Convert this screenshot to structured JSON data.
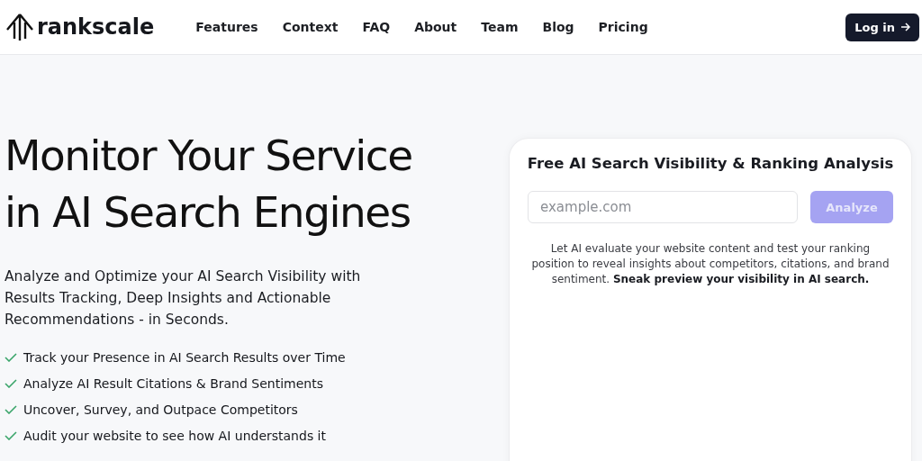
{
  "header": {
    "brand": "rankscale",
    "nav": [
      {
        "label": "Features"
      },
      {
        "label": "Context"
      },
      {
        "label": "FAQ"
      },
      {
        "label": "About"
      },
      {
        "label": "Team"
      },
      {
        "label": "Blog"
      },
      {
        "label": "Pricing"
      }
    ],
    "login_button": "Log in"
  },
  "hero": {
    "title_lines": [
      "Monitor Your Service",
      "in AI Search Engines"
    ],
    "subtitle": "Analyze and Optimize your AI Search Visibility with Results Tracking, Deep Insights and Actionable Recommendations - in Seconds.",
    "features": [
      "Track your Presence in AI Search Results over Time",
      "Analyze AI Result Citations & Brand Sentiments",
      "Uncover, Survey, and Outpace Competitors",
      "Audit your website to see how AI understands it"
    ]
  },
  "analysis_card": {
    "title": "Free AI Search Visibility & Ranking Analysis",
    "url_field": {
      "placeholder": "example.com"
    },
    "analyze_button": {
      "label": "Analyze",
      "disabled": true
    },
    "description": "Let AI evaluate your website content and test your ranking position to reveal insights about competitors, citations, and brand sentiment. **Sneak preview your visibility in AI search.**"
  }
}
